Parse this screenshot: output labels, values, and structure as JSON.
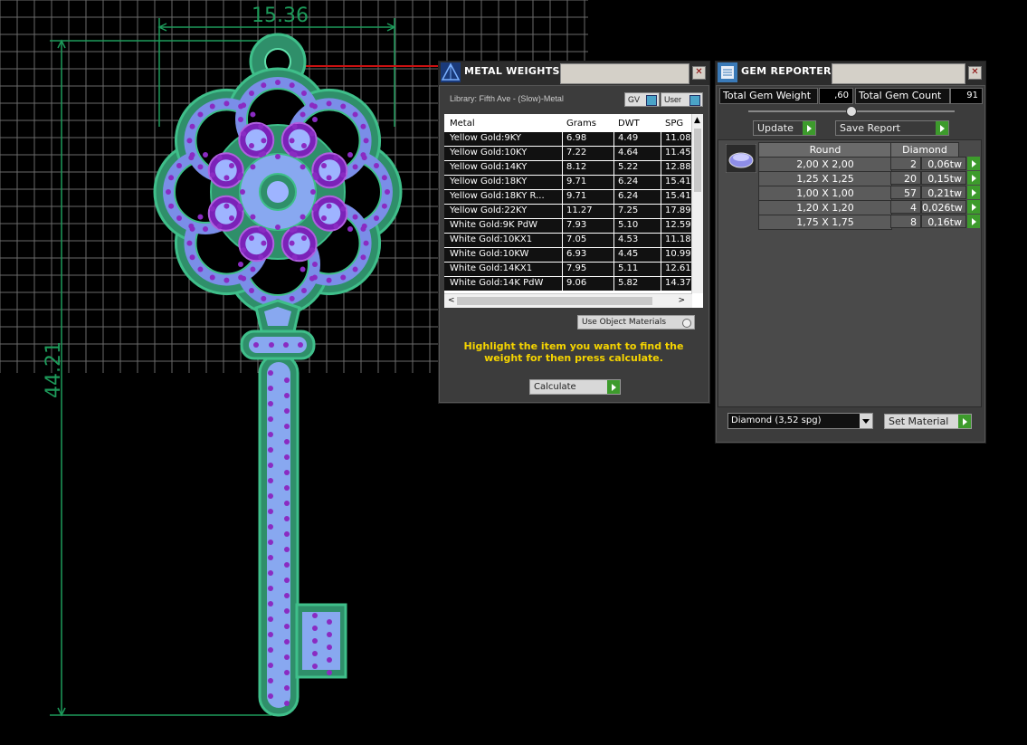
{
  "cad": {
    "dim_width": "15.36",
    "dim_height": "44.21"
  },
  "metal_panel": {
    "title": "METAL WEIGHTS",
    "library": "Library: Fifth Ave - (Slow)-Metal",
    "gv_label": "GV",
    "user_label": "User",
    "columns": [
      "Metal",
      "Grams",
      "DWT",
      "SPG"
    ],
    "rows": [
      [
        "Yellow Gold:9KY",
        "6.98",
        "4.49",
        "11.08"
      ],
      [
        "Yellow Gold:10KY",
        "7.22",
        "4.64",
        "11.45"
      ],
      [
        "Yellow Gold:14KY",
        "8.12",
        "5.22",
        "12.88"
      ],
      [
        "Yellow Gold:18KY",
        "9.71",
        "6.24",
        "15.41"
      ],
      [
        "Yellow Gold:18KY R...",
        "9.71",
        "6.24",
        "15.41"
      ],
      [
        "Yellow Gold:22KY",
        "11.27",
        "7.25",
        "17.89"
      ],
      [
        "White Gold:9K PdW",
        "7.93",
        "5.10",
        "12.59"
      ],
      [
        "White Gold:10KX1",
        "7.05",
        "4.53",
        "11.18"
      ],
      [
        "White Gold:10KW",
        "6.93",
        "4.45",
        "10.99"
      ],
      [
        "White Gold:14KX1",
        "7.95",
        "5.11",
        "12.61"
      ],
      [
        "White Gold:14K PdW",
        "9.06",
        "5.82",
        "14.37"
      ]
    ],
    "use_object_materials": "Use Object Materials",
    "hint": "Highlight the item you want to find the weight for then press calculate.",
    "calculate": "Calculate"
  },
  "gem_panel": {
    "title": "GEM REPORTER",
    "total_weight_label": "Total Gem Weight",
    "total_weight_value": ",60",
    "total_count_label": "Total Gem Count",
    "total_count_value": "91",
    "update": "Update",
    "save_report": "Save Report",
    "header_shape": "Round",
    "header_material": "Diamond",
    "rows": [
      [
        "2,00 X 2,00",
        "2",
        "0,06tw"
      ],
      [
        "1,25 X 1,25",
        "20",
        "0,15tw"
      ],
      [
        "1,00 X 1,00",
        "57",
        "0,21tw"
      ],
      [
        "1,20 X 1,20",
        "4",
        "0,026tw"
      ],
      [
        "1,75 X 1,75",
        "8",
        "0,16tw"
      ]
    ],
    "material_select": "Diamond      (3,52 spg)",
    "set_material": "Set Material"
  }
}
